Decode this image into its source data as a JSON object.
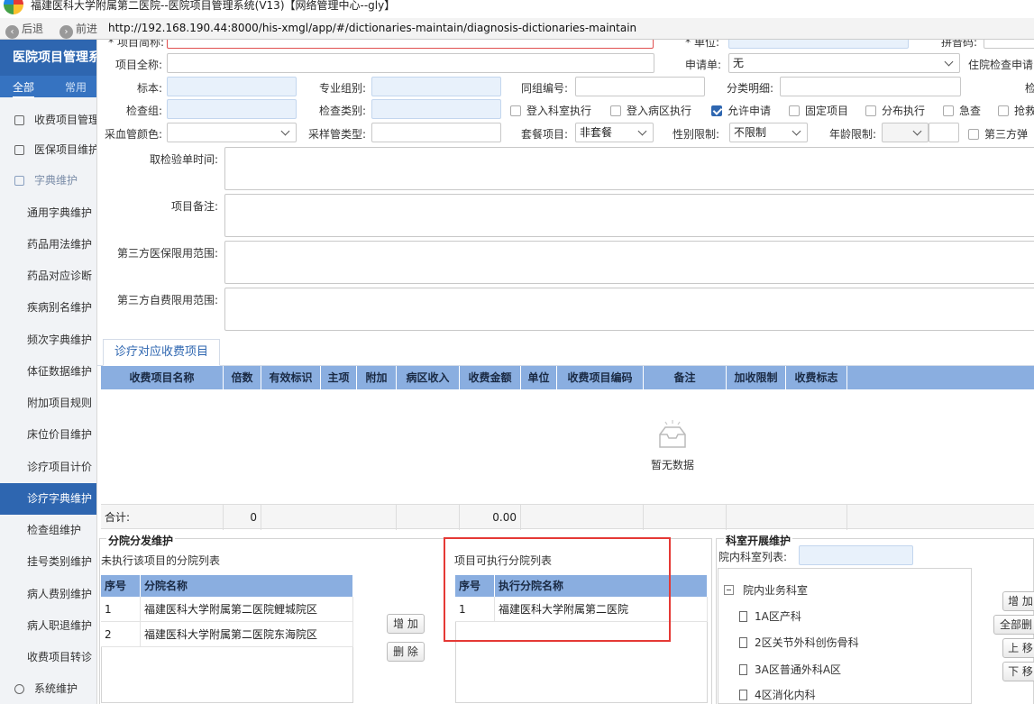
{
  "window": {
    "title": "福建医科大学附属第二医院--医院项目管理系统(V13)【网络管理中心--gly】"
  },
  "browser": {
    "back_label": "后退",
    "forward_label": "前进",
    "url": "http://192.168.190.44:8000/his-xmgl/app/#/dictionaries-maintain/diagnosis-dictionaries-maintain"
  },
  "sidebar": {
    "app_title": "医院项目管理系统",
    "tabs": {
      "all": "全部",
      "common": "常用"
    },
    "top_items": [
      {
        "label": "收费项目管理",
        "icon": "fee-icon"
      },
      {
        "label": "医保项目维护",
        "icon": "card-icon"
      },
      {
        "label": "字典维护",
        "icon": "dictionary-icon"
      }
    ],
    "sub_items": [
      "通用字典维护",
      "药品用法维护",
      "药品对应诊断",
      "疾病别名维护",
      "频次字典维护",
      "体征数据维护",
      "附加项目规则",
      "床位价目维护",
      "诊疗项目计价",
      "诊疗字典维护",
      "检查组维护",
      "挂号类别维护",
      "病人费别维护",
      "病人职退维护",
      "收费项目转诊"
    ],
    "active_item": "诊疗字典维护",
    "bottom_item": {
      "label": "系统维护",
      "icon": "gear-icon"
    }
  },
  "form": {
    "row0": {
      "name_label": "* 项目简称:",
      "unit_label": "* 单位:",
      "pinyin_label": "拼音码:"
    },
    "full_name_label": "项目全称:",
    "apply_label": "申请单:",
    "apply_value": "无",
    "inpatient_label": "住院检查申请",
    "standard_label": "标本:",
    "specialty_label": "专业组别:",
    "group_no_label": "同组编号:",
    "class_detail_label": "分类明细:",
    "extra_label": "检",
    "check_group_label": "检查组:",
    "check_type_label": "检查类别:",
    "checkboxes": [
      {
        "label": "登入科室执行",
        "checked": false
      },
      {
        "label": "登入病区执行",
        "checked": false
      },
      {
        "label": "允许申请",
        "checked": true
      },
      {
        "label": "固定项目",
        "checked": false
      },
      {
        "label": "分布执行",
        "checked": false
      },
      {
        "label": "急查",
        "checked": false
      },
      {
        "label": "抢救",
        "checked": false
      }
    ],
    "tube_color_label": "采血管颜色:",
    "tube_type_label": "采样管类型:",
    "package_label": "套餐项目:",
    "package_value": "非套餐",
    "gender_label": "性别限制:",
    "gender_value": "不限制",
    "age_label": "年龄限制:",
    "third_party_label": "第三方弹",
    "report_time_label": "取检验单时间:",
    "remark_label": "项目备注:",
    "insurance_range_label": "第三方医保限用范围:",
    "selfpay_range_label": "第三方自费限用范围:"
  },
  "fee_section": {
    "tab_label": "诊疗对应收费项目",
    "columns": [
      "收费项目名称",
      "倍数",
      "有效标识",
      "主项",
      "附加",
      "病区收入",
      "收费金额",
      "单位",
      "收费项目编码",
      "备注",
      "加收限制",
      "收费标志"
    ],
    "empty_text": "暂无数据",
    "sum_label": "合计:",
    "sum_multiple": "0",
    "sum_amount": "0.00"
  },
  "branch_section": {
    "title": "分院分发维护",
    "not_exec_title": "未执行该项目的分院列表",
    "not_exec_columns": [
      "序号",
      "分院名称"
    ],
    "not_exec_rows": [
      {
        "no": "1",
        "name": "福建医科大学附属第二医院鲤城院区"
      },
      {
        "no": "2",
        "name": "福建医科大学附属第二医院东海院区"
      }
    ],
    "add_label": "增 加",
    "delete_label": "删 除",
    "exec_title": "项目可执行分院列表",
    "exec_columns": [
      "序号",
      "执行分院名称"
    ],
    "exec_rows": [
      {
        "no": "1",
        "name": "福建医科大学附属第二医院"
      }
    ]
  },
  "dept_section": {
    "title": "科室开展维护",
    "list_label": "院内科室列表:",
    "root": "院内业务科室",
    "children": [
      "1A区产科",
      "2区关节外科创伤骨科",
      "3A区普通外科A区",
      "4区消化内科"
    ],
    "buttons": {
      "add": "增 加",
      "delete_all": "全部删",
      "up": "上 移",
      "down": "下 移"
    }
  }
}
